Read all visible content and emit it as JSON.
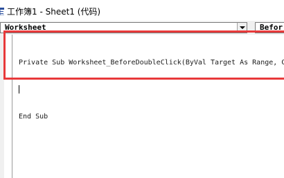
{
  "window": {
    "title": "工作簿1 - Sheet1 (代码)",
    "icon": "vba-module-icon"
  },
  "combos": {
    "object_value": "Worksheet",
    "procedure_value": "Befor"
  },
  "code": {
    "line1": "Private Sub Worksheet_BeforeDoubleClick(ByVal Target As Range, C",
    "line3": "End Sub"
  },
  "colors": {
    "highlight_border": "#e8393a",
    "editor_bg": "#ffffff",
    "chrome_bg": "#f0f0f0"
  }
}
